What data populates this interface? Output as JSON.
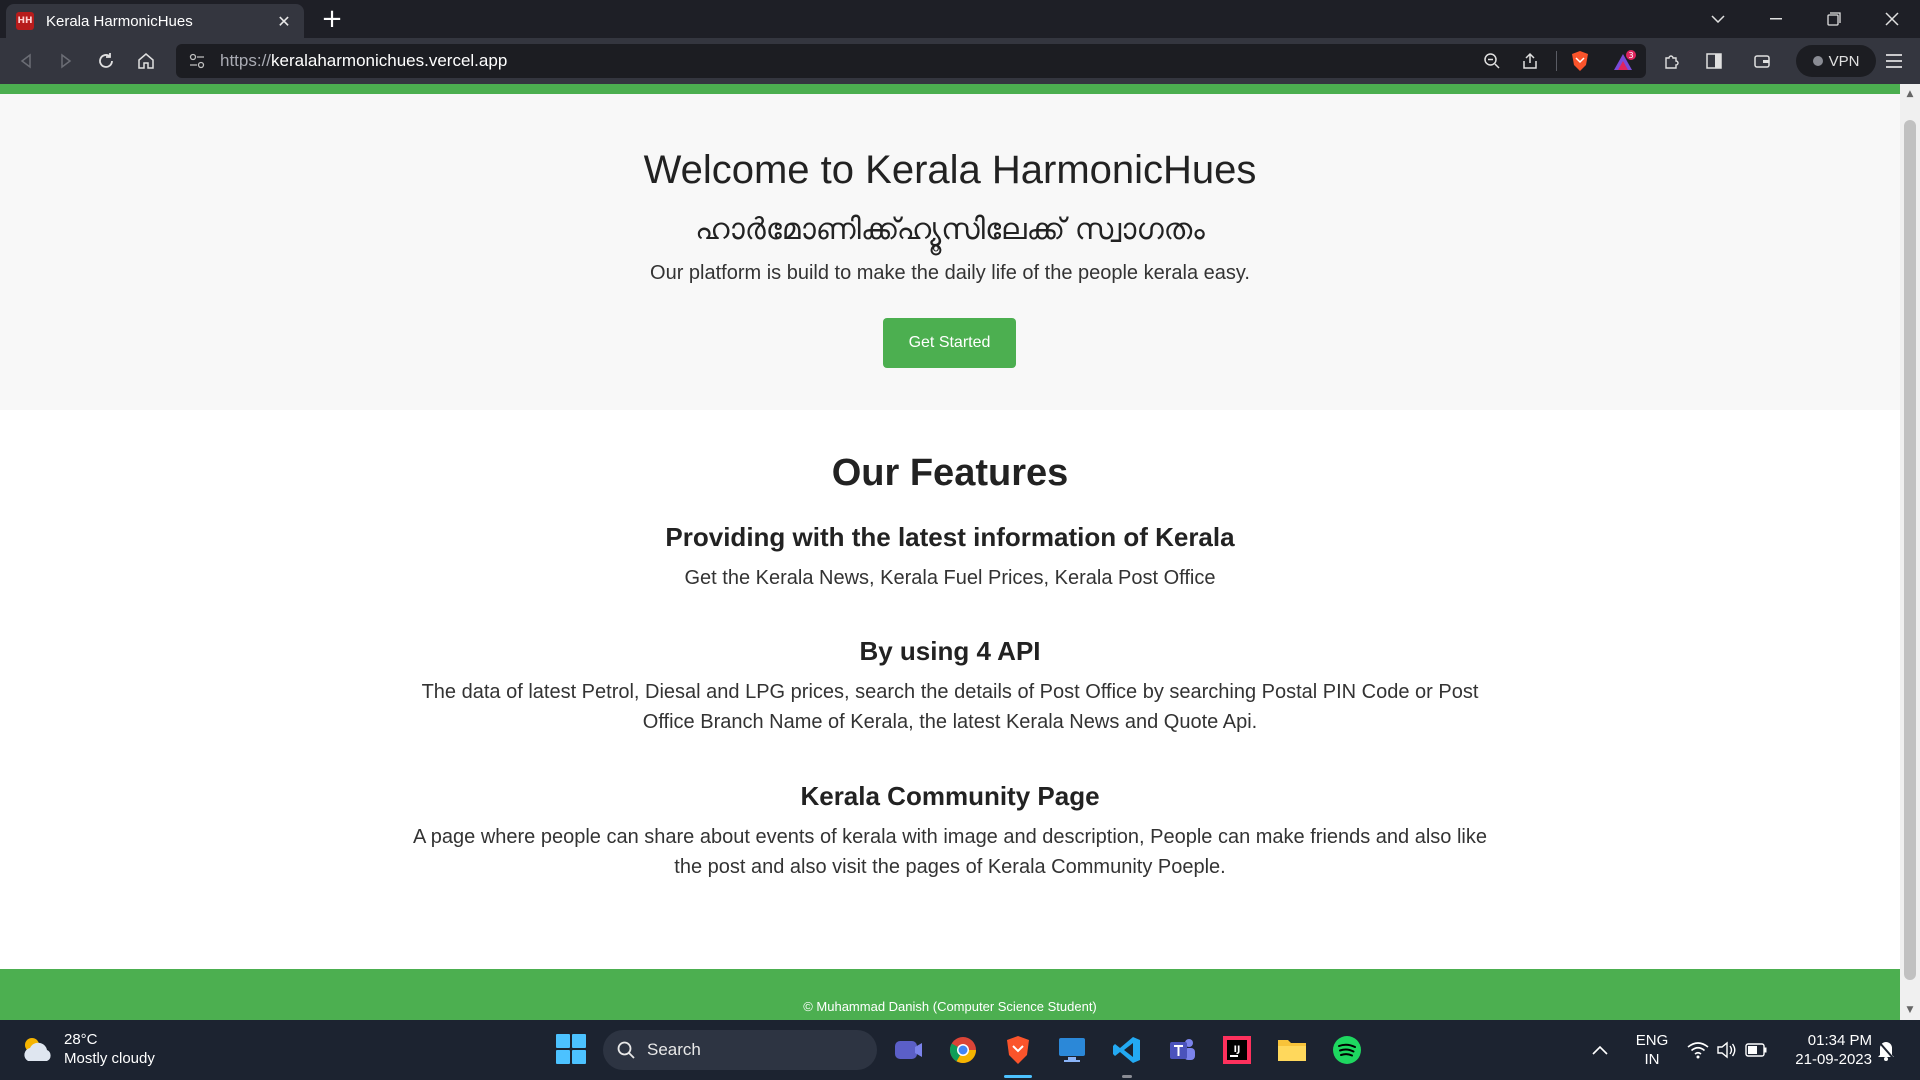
{
  "browser": {
    "tab_title": "Kerala HarmonicHues",
    "tab_favicon_text": "HH",
    "url_scheme": "https://",
    "url_host": "keralaharmonichues.vercel.app",
    "vpn_label": "VPN",
    "shields_badge": "3"
  },
  "hero": {
    "title": "Welcome to Kerala HarmonicHues",
    "malayalam": "ഹാർമോണിക്ക്ഹ്യൂസിലേക്ക് സ്വാഗതം",
    "subtitle": "Our platform is build to make the daily life of the people kerala easy.",
    "cta_label": "Get Started"
  },
  "features": {
    "title": "Our Features",
    "items": [
      {
        "title": "Providing with the latest information of Kerala",
        "description": "Get the Kerala News, Kerala Fuel Prices, Kerala Post Office"
      },
      {
        "title": "By using 4 API",
        "description": "The data of latest Petrol, Diesal and LPG prices, search the details of Post Office by searching Postal PIN Code or Post Office Branch Name of Kerala, the latest Kerala News and Quote Api."
      },
      {
        "title": "Kerala Community Page",
        "description": "A page where people can share about events of kerala with image and description, People can make friends and also like the post and also visit the pages of Kerala Community Poeple."
      }
    ]
  },
  "footer": {
    "text": "© Muhammad Danish (Computer Science Student)"
  },
  "taskbar": {
    "weather_temp": "28°C",
    "weather_desc": "Mostly cloudy",
    "search_label": "Search",
    "lang_line1": "ENG",
    "lang_line2": "IN",
    "time": "01:34 PM",
    "date": "21-09-2023"
  },
  "colors": {
    "accent_green": "#4caf50",
    "browser_dark": "#1e1f26",
    "taskbar_bg": "#1c2330"
  }
}
